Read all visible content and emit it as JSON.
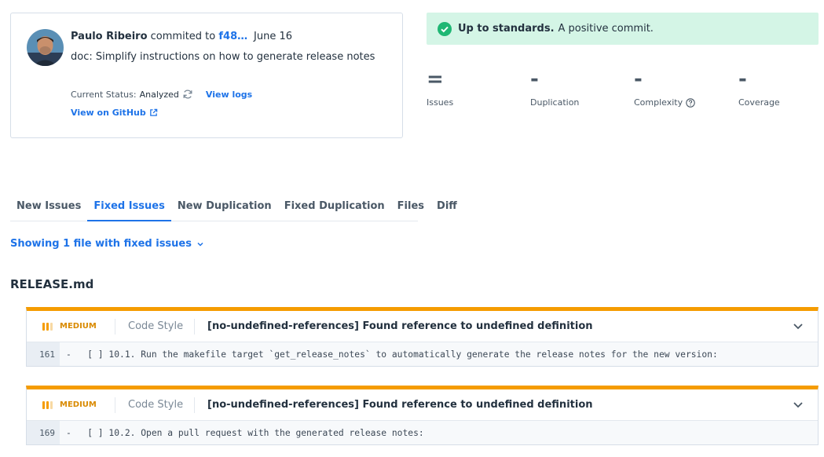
{
  "commit": {
    "author": "Paulo Ribeiro",
    "committed_to": "commited to",
    "sha": "f48…",
    "date": "June 16",
    "message": "doc: Simplify instructions on how to generate release notes",
    "status_label": "Current Status:",
    "status_value": "Analyzed",
    "view_logs": "View logs",
    "view_github": "View on GitHub"
  },
  "banner": {
    "strong": "Up to standards.",
    "text": "A positive commit.",
    "color": "#d4f5e6"
  },
  "metrics": [
    {
      "symbol": "=",
      "label": "Issues"
    },
    {
      "symbol": "-",
      "label": "Duplication"
    },
    {
      "symbol": "-",
      "label": "Complexity"
    },
    {
      "symbol": "-",
      "label": "Coverage"
    }
  ],
  "tabs": [
    {
      "label": "New Issues"
    },
    {
      "label": "Fixed Issues"
    },
    {
      "label": "New Duplication"
    },
    {
      "label": "Fixed Duplication"
    },
    {
      "label": "Files"
    },
    {
      "label": "Diff"
    }
  ],
  "showing": "Showing 1 file with fixed issues",
  "file_name": "RELEASE.md",
  "issues": [
    {
      "severity": "MEDIUM",
      "category": "Code Style",
      "title": "[no-undefined-references] Found reference to undefined definition",
      "line": "161",
      "code": "-   [ ] 10.1. Run the makefile target `get_release_notes` to automatically generate the release notes for the new version:"
    },
    {
      "severity": "MEDIUM",
      "category": "Code Style",
      "title": "[no-undefined-references] Found reference to undefined definition",
      "line": "169",
      "code": "-   [ ] 10.2. Open a pull request with the generated release notes:"
    }
  ]
}
